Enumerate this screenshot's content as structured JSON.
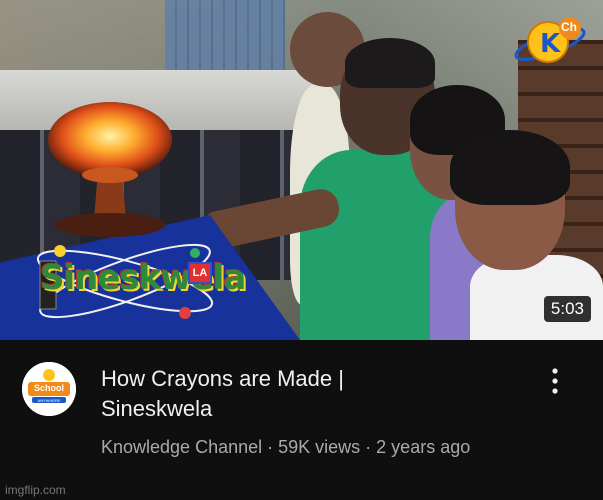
{
  "video": {
    "duration": "5:03",
    "title_line1": "How Crayons are Made |",
    "title_line2": "Sineskwela",
    "channel": "Knowledge Channel",
    "views": "59K views",
    "age": "2 years ago",
    "separator": " · "
  },
  "overlay_logos": {
    "channel_logo_text": "Ch",
    "program_logo_text": "Sineskwela",
    "program_logo_badge": "LA"
  },
  "avatar": {
    "line1": "School",
    "line2": "ANYWHERE"
  },
  "watermark": "imgflip.com",
  "colors": {
    "background": "#0f0f0f",
    "title": "#f1f1f1",
    "secondary_text": "#aaaaaa",
    "wedge": "#17329a"
  }
}
